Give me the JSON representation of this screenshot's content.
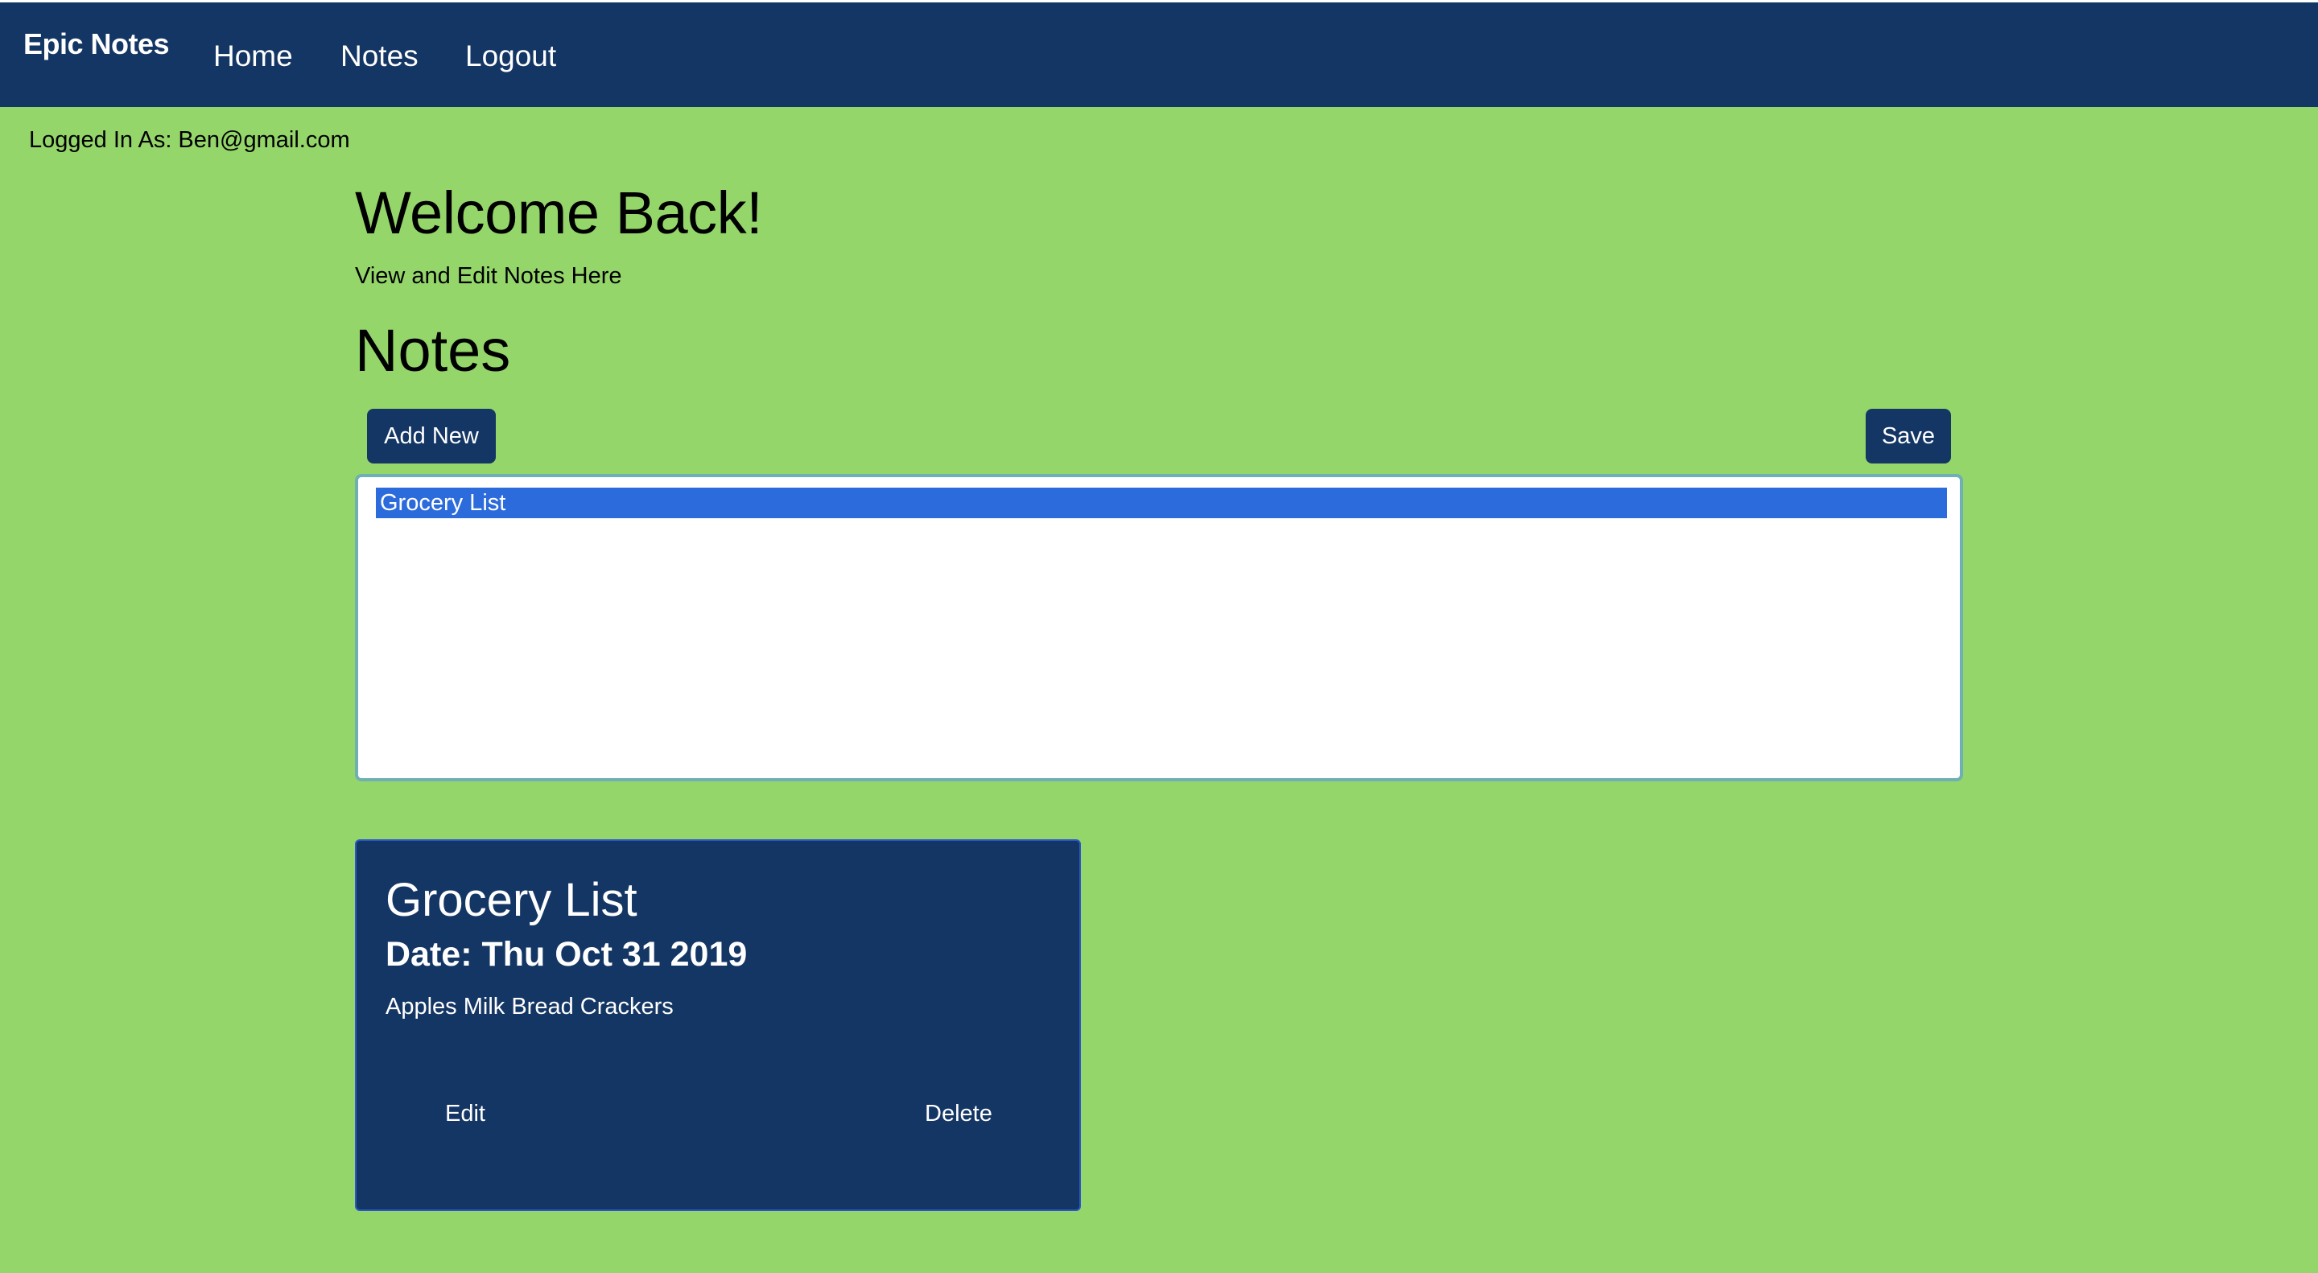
{
  "navbar": {
    "brand": "Epic Notes",
    "links": [
      "Home",
      "Notes",
      "Logout"
    ]
  },
  "user": {
    "logged_in_text": "Logged In As: Ben@gmail.com"
  },
  "main": {
    "welcome": "Welcome Back!",
    "subtitle": "View and Edit Notes Here",
    "notes_heading": "Notes",
    "add_new_label": "Add New",
    "save_label": "Save",
    "editor_content": "Grocery List"
  },
  "note_card": {
    "title": "Grocery List",
    "date": "Date: Thu Oct 31 2019",
    "body": "Apples Milk Bread Crackers",
    "edit_label": "Edit",
    "delete_label": "Delete"
  },
  "colors": {
    "background": "#95d66b",
    "navbar": "#143664",
    "selection": "#2c6bdb"
  }
}
